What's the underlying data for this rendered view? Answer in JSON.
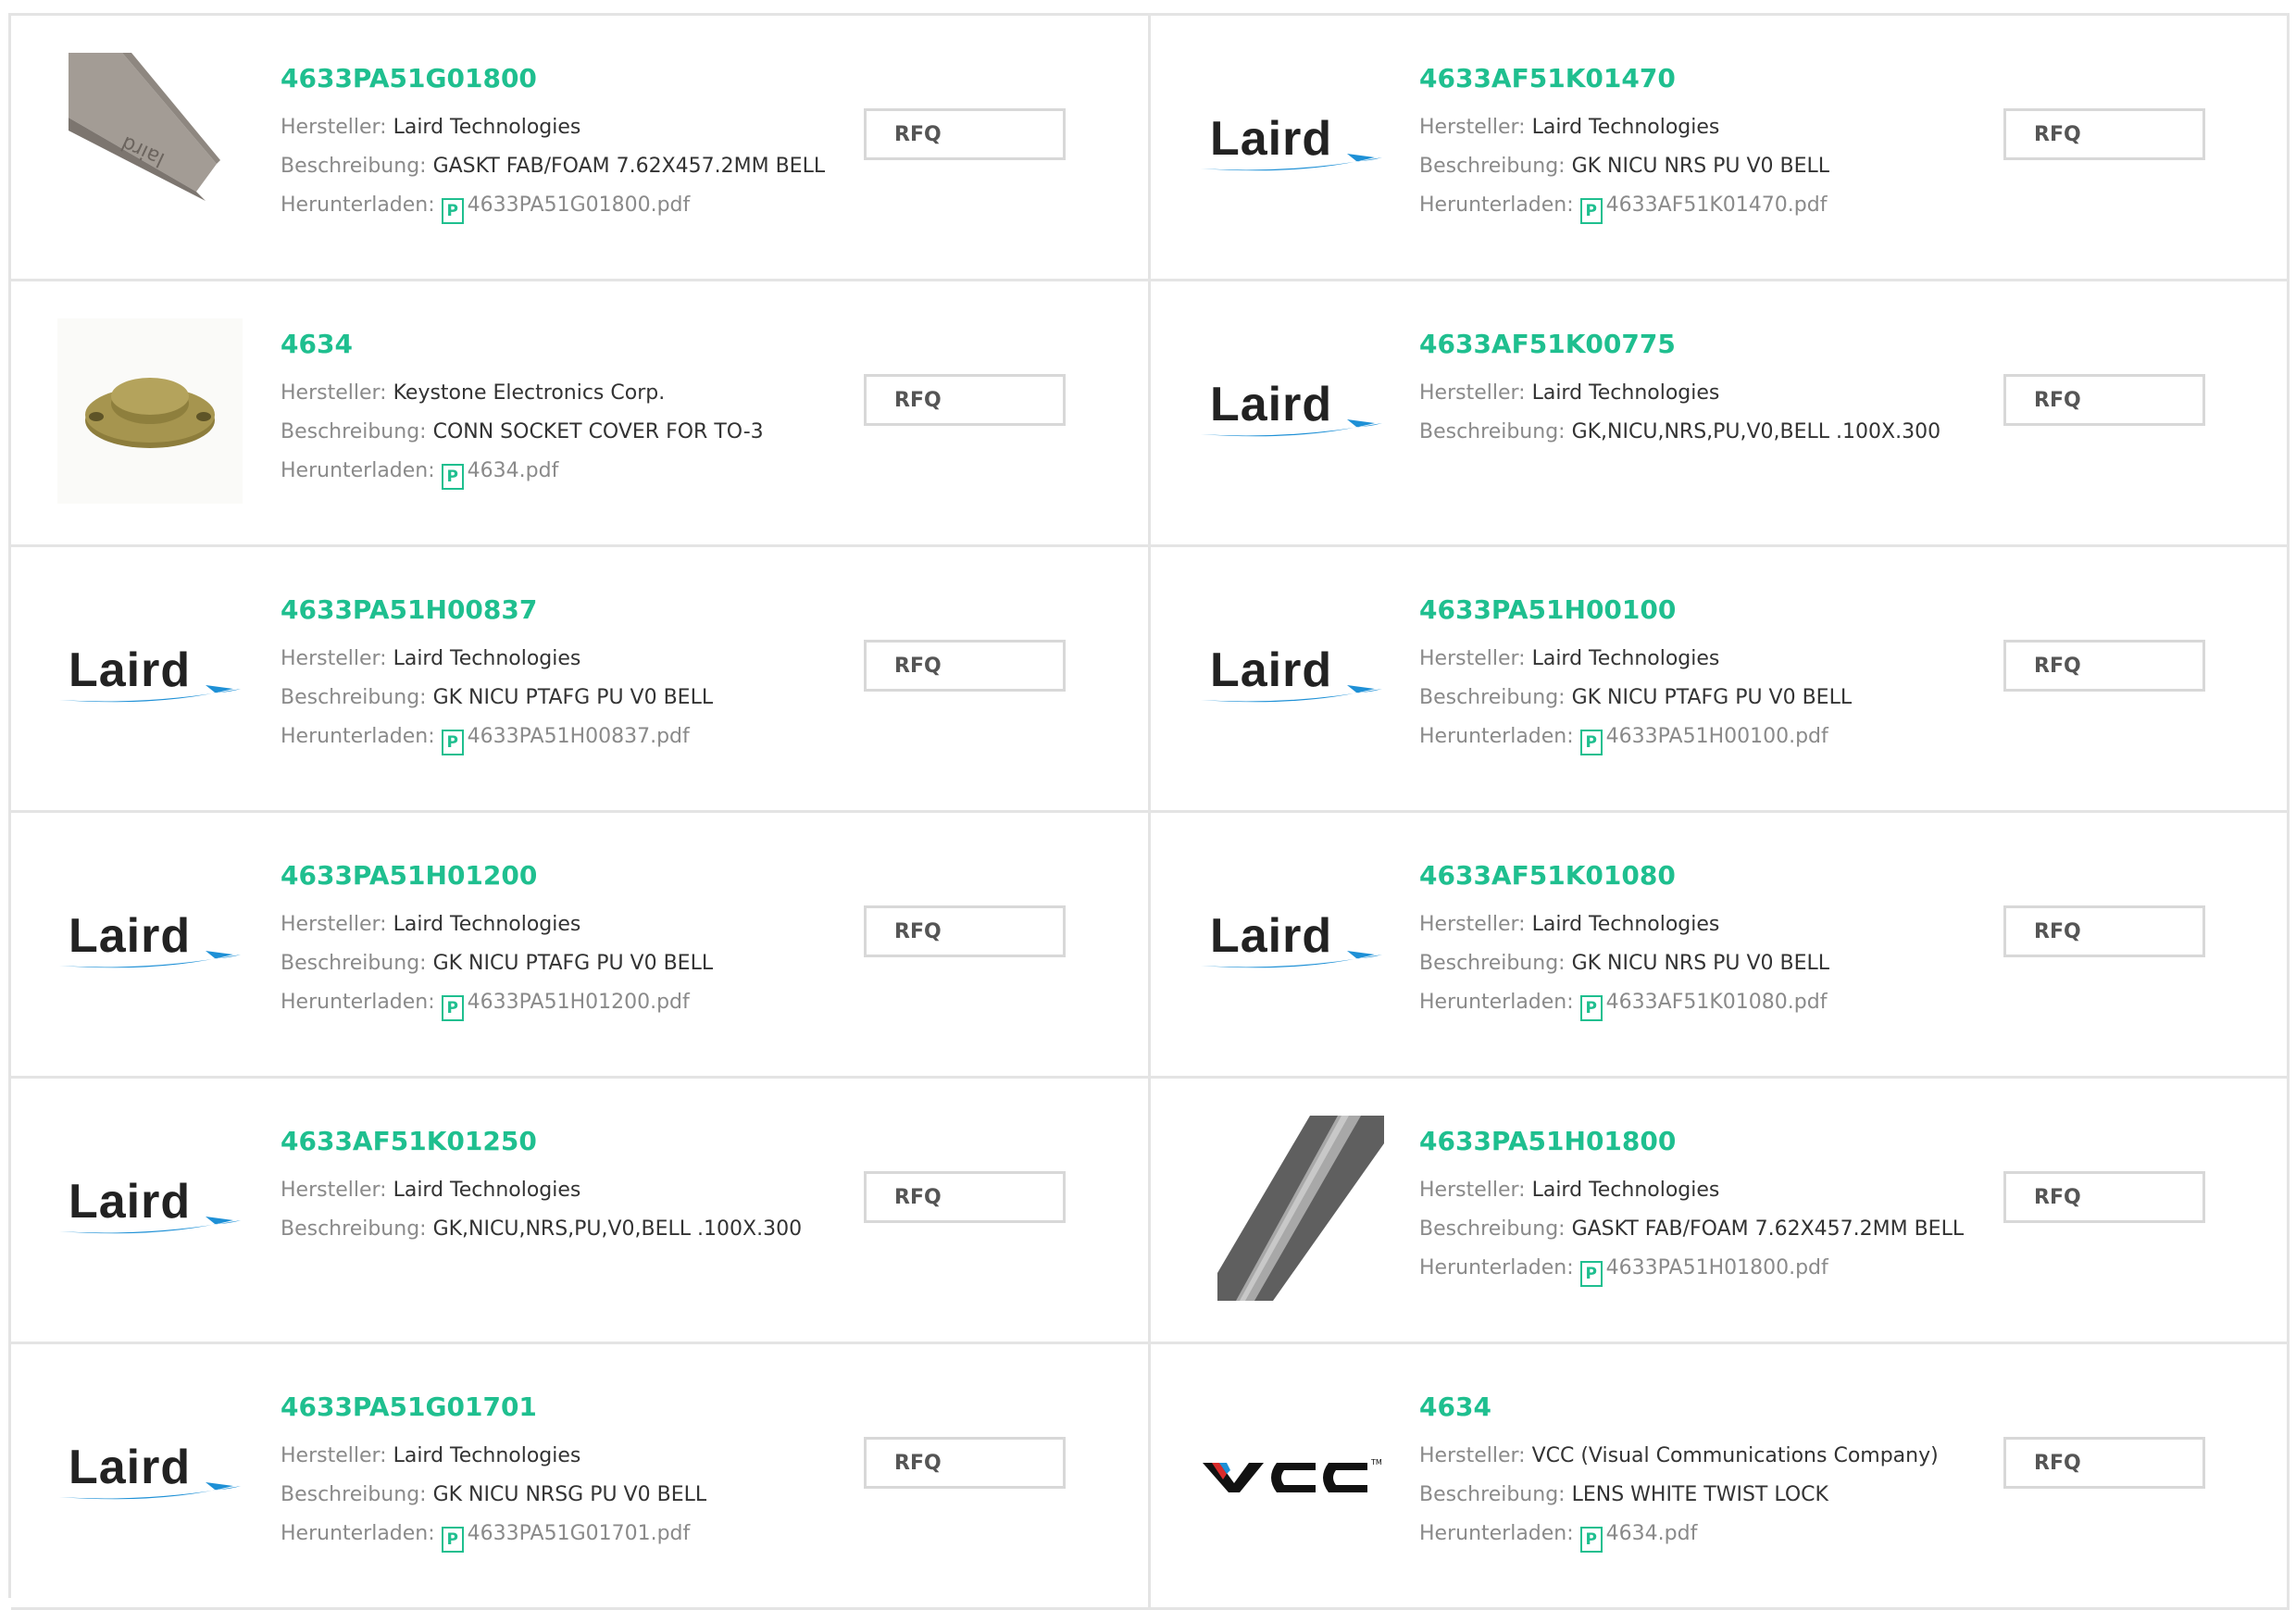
{
  "labels": {
    "manufacturer": "Hersteller:",
    "description": "Beschreibung:",
    "download": "Herunterladen:",
    "rfq": "RFQ"
  },
  "colors": {
    "accent": "#1fbf8f",
    "laird_swoosh": "#1e90d6"
  },
  "products": [
    {
      "image": "gasket-strip-photo",
      "part_number": "4633PA51G01800",
      "manufacturer": "Laird Technologies",
      "description": "GASKT FAB/FOAM 7.62X457.2MM BELL",
      "pdf": "4633PA51G01800.pdf"
    },
    {
      "image": "laird-logo",
      "logo_text": "Laird",
      "part_number": "4633AF51K01470",
      "manufacturer": "Laird Technologies",
      "description": "GK NICU NRS PU V0 BELL",
      "pdf": "4633AF51K01470.pdf"
    },
    {
      "image": "socket-cover-photo",
      "part_number": "4634",
      "manufacturer": "Keystone Electronics Corp.",
      "description": "CONN SOCKET COVER FOR TO-3",
      "pdf": "4634.pdf"
    },
    {
      "image": "laird-logo",
      "logo_text": "Laird",
      "part_number": "4633AF51K00775",
      "manufacturer": "Laird Technologies",
      "description": "GK,NICU,NRS,PU,V0,BELL .100X.300",
      "pdf": ""
    },
    {
      "image": "laird-logo",
      "logo_text": "Laird",
      "part_number": "4633PA51H00837",
      "manufacturer": "Laird Technologies",
      "description": "GK NICU PTAFG PU V0 BELL",
      "pdf": "4633PA51H00837.pdf"
    },
    {
      "image": "laird-logo",
      "logo_text": "Laird",
      "part_number": "4633PA51H00100",
      "manufacturer": "Laird Technologies",
      "description": "GK NICU PTAFG PU V0 BELL",
      "pdf": "4633PA51H00100.pdf"
    },
    {
      "image": "laird-logo",
      "logo_text": "Laird",
      "part_number": "4633PA51H01200",
      "manufacturer": "Laird Technologies",
      "description": "GK NICU PTAFG PU V0 BELL",
      "pdf": "4633PA51H01200.pdf"
    },
    {
      "image": "laird-logo",
      "logo_text": "Laird",
      "part_number": "4633AF51K01080",
      "manufacturer": "Laird Technologies",
      "description": "GK NICU NRS PU V0 BELL",
      "pdf": "4633AF51K01080.pdf"
    },
    {
      "image": "laird-logo",
      "logo_text": "Laird",
      "part_number": "4633AF51K01250",
      "manufacturer": "Laird Technologies",
      "description": "GK,NICU,NRS,PU,V0,BELL .100X.300",
      "pdf": ""
    },
    {
      "image": "gasket-strip-dark-photo",
      "part_number": "4633PA51H01800",
      "manufacturer": "Laird Technologies",
      "description": "GASKT FAB/FOAM 7.62X457.2MM BELL",
      "pdf": "4633PA51H01800.pdf"
    },
    {
      "image": "laird-logo",
      "logo_text": "Laird",
      "part_number": "4633PA51G01701",
      "manufacturer": "Laird Technologies",
      "description": "GK NICU NRSG PU V0 BELL",
      "pdf": "4633PA51G01701.pdf"
    },
    {
      "image": "vcc-logo",
      "logo_text": "VCC",
      "part_number": "4634",
      "manufacturer": "VCC (Visual Communications Company)",
      "description": "LENS WHITE TWIST LOCK",
      "pdf": "4634.pdf"
    }
  ]
}
